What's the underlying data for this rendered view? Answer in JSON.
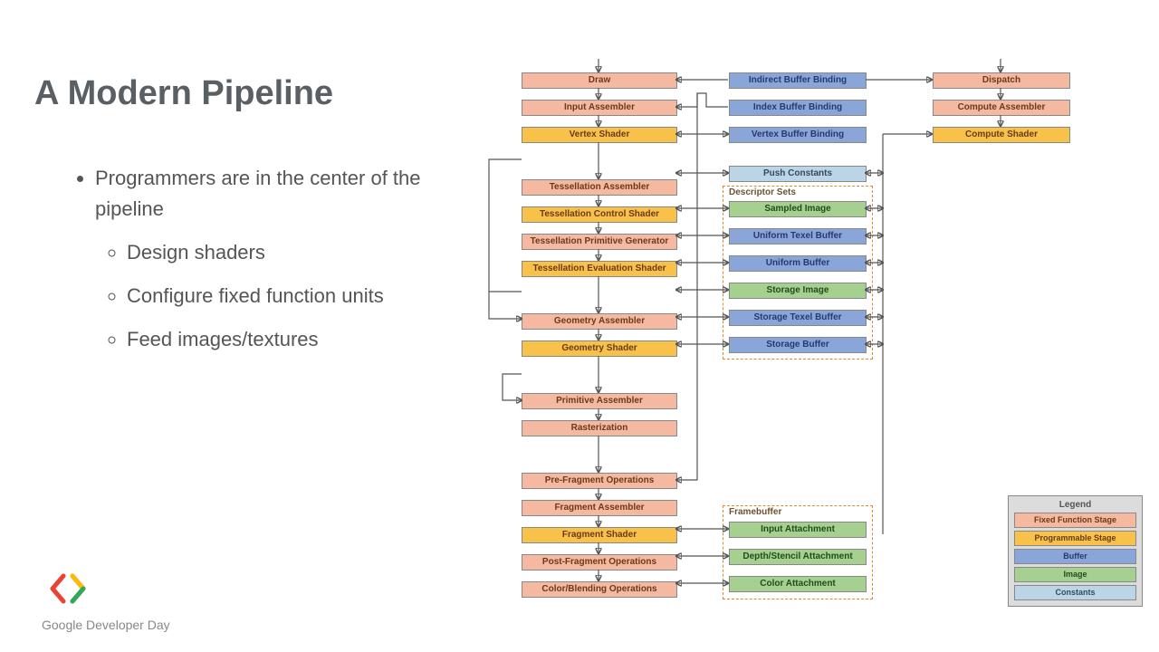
{
  "title": "A Modern Pipeline",
  "bullets": {
    "main1": "Programmers are in the center of the pipeline",
    "sub1": "Design shaders",
    "sub2": "Configure fixed function units",
    "sub3": "Feed images/textures"
  },
  "brand": "Google Developer Day",
  "legend": {
    "title": "Legend",
    "ff": "Fixed Function Stage",
    "ps": "Programmable Stage",
    "bf": "Buffer",
    "im": "Image",
    "cn": "Constants"
  },
  "pipeline": {
    "draw": "Draw",
    "input_asm": "Input Assembler",
    "vertex_shader": "Vertex Shader",
    "tess_asm": "Tessellation Assembler",
    "tess_ctrl": "Tessellation Control Shader",
    "tess_prim": "Tessellation Primitive Generator",
    "tess_eval": "Tessellation Evaluation Shader",
    "geom_asm": "Geometry Assembler",
    "geom_shader": "Geometry Shader",
    "prim_asm": "Primitive Assembler",
    "raster": "Rasterization",
    "pre_frag": "Pre-Fragment Operations",
    "frag_asm": "Fragment Assembler",
    "frag_shader": "Fragment Shader",
    "post_frag": "Post-Fragment Operations",
    "color_blend": "Color/Blending Operations"
  },
  "resources": {
    "indirect": "Indirect Buffer Binding",
    "index": "Index Buffer Binding",
    "vertex": "Vertex Buffer Binding",
    "push": "Push Constants",
    "dset_label": "Descriptor Sets",
    "sampled": "Sampled Image",
    "utb": "Uniform Texel Buffer",
    "ub": "Uniform Buffer",
    "si": "Storage Image",
    "stb": "Storage Texel Buffer",
    "sb": "Storage Buffer",
    "fb_label": "Framebuffer",
    "input_att": "Input Attachment",
    "ds_att": "Depth/Stencil Attachment",
    "color_att": "Color Attachment"
  },
  "compute": {
    "dispatch": "Dispatch",
    "asm": "Compute Assembler",
    "shader": "Compute Shader"
  }
}
